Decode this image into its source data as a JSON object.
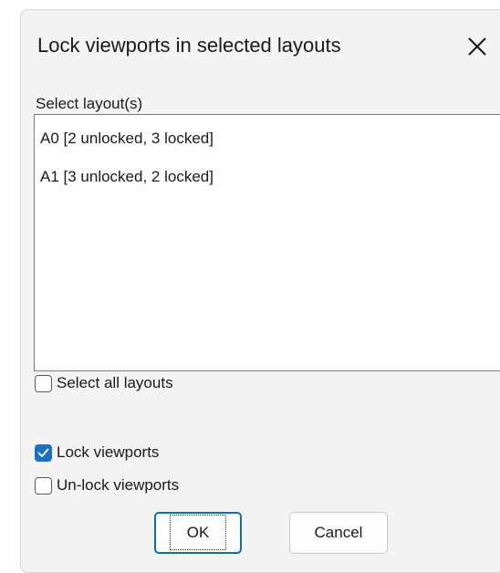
{
  "dialog": {
    "title": "Lock viewports in selected layouts",
    "list_label": "Select layout(s)",
    "layouts": [
      "A0 [2 unlocked, 3 locked]",
      "A1 [3 unlocked, 2 locked]"
    ],
    "select_all": {
      "label": "Select all layouts",
      "checked": false
    },
    "lock_viewports": {
      "label": "Lock viewports",
      "checked": true
    },
    "unlock_viewports": {
      "label": "Un-lock viewports",
      "checked": false
    },
    "ok_label": "OK",
    "cancel_label": "Cancel"
  },
  "colors": {
    "accent": "#1d6fc4",
    "dialog_bg": "#f3f3f3",
    "list_bg": "#ffffff"
  },
  "icons": {
    "close": "close-icon",
    "checkmark": "checkmark-icon"
  }
}
